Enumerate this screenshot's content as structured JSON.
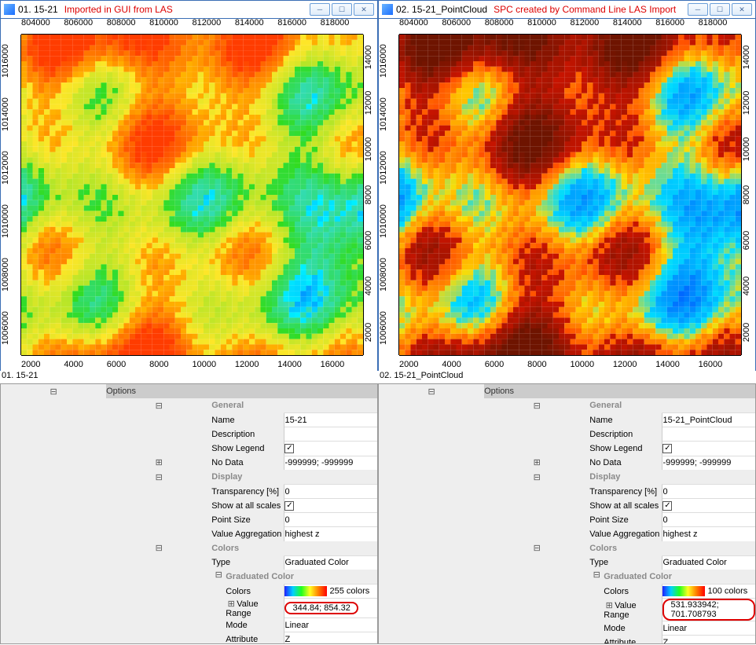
{
  "left": {
    "title": "01. 15-21",
    "annotation": "Imported in GUI from LAS",
    "top_ticks": [
      "804000",
      "806000",
      "808000",
      "810000",
      "812000",
      "814000",
      "816000",
      "818000"
    ],
    "bot_ticks": [
      "2000",
      "4000",
      "6000",
      "8000",
      "10000",
      "12000",
      "14000",
      "16000"
    ],
    "left_ticks": [
      "1006000",
      "1008000",
      "1010000",
      "1012000",
      "1014000",
      "1016000"
    ],
    "right_ticks": [
      "2000",
      "4000",
      "6000",
      "8000",
      "10000",
      "12000",
      "14000"
    ],
    "prop_title": "01. 15-21",
    "props": {
      "name": "15-21",
      "desc": "",
      "show_legend": true,
      "nodata": "-999999; -999999",
      "transparency": "0",
      "all_scales": true,
      "point_size": "0",
      "agg": "highest z",
      "type": "Graduated Color",
      "colors_count": "255 colors",
      "value_range": "344.84; 854.32",
      "mode": "Linear",
      "attribute": "Z"
    }
  },
  "right": {
    "title": "02. 15-21_PointCloud",
    "annotation": "SPC created by Command Line LAS Import",
    "top_ticks": [
      "804000",
      "806000",
      "808000",
      "810000",
      "812000",
      "814000",
      "816000",
      "818000"
    ],
    "bot_ticks": [
      "2000",
      "4000",
      "6000",
      "8000",
      "10000",
      "12000",
      "14000",
      "16000"
    ],
    "left_ticks": [
      "1006000",
      "1008000",
      "1010000",
      "1012000",
      "1014000",
      "1016000"
    ],
    "right_ticks": [
      "2000",
      "4000",
      "6000",
      "8000",
      "10000",
      "12000",
      "14000"
    ],
    "prop_title": "02. 15-21_PointCloud",
    "props": {
      "name": "15-21_PointCloud",
      "desc": "",
      "show_legend": true,
      "nodata": "-999999; -999999",
      "transparency": "0",
      "all_scales": true,
      "point_size": "0",
      "agg": "highest z",
      "type": "Graduated Color",
      "colors_count": "100 colors",
      "value_range": "531.933942; 701.708793",
      "mode": "Linear",
      "attribute": "Z"
    }
  },
  "labels": {
    "options": "Options",
    "general": "General",
    "name": "Name",
    "description": "Description",
    "show_legend": "Show Legend",
    "nodata": "No Data",
    "display": "Display",
    "transparency": "Transparency [%]",
    "all_scales": "Show at all scales",
    "point_size": "Point Size",
    "agg": "Value Aggregation",
    "colors": "Colors",
    "type": "Type",
    "gradcolor": "Graduated Color",
    "colors2": "Colors",
    "value_range": "Value Range",
    "mode": "Mode",
    "attribute": "Attribute"
  },
  "glyphs": {
    "minus": "⊟",
    "plus": "⊞",
    "check": "✓",
    "min": "─",
    "max": "☐",
    "close": "✕"
  }
}
